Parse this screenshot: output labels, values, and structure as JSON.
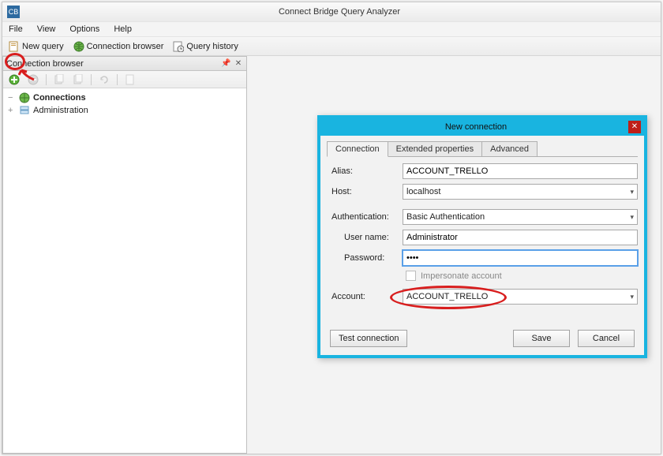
{
  "app": {
    "title": "Connect Bridge Query Analyzer",
    "icon_label": "CB"
  },
  "menu": {
    "file": "File",
    "view": "View",
    "options": "Options",
    "help": "Help"
  },
  "toolbar": {
    "new_query": "New query",
    "connection_browser": "Connection browser",
    "query_history": "Query history"
  },
  "side_panel": {
    "title": "Connection browser",
    "tree": {
      "connections": "Connections",
      "administration": "Administration"
    }
  },
  "dialog": {
    "title": "New connection",
    "tabs": {
      "connection": "Connection",
      "extended": "Extended properties",
      "advanced": "Advanced"
    },
    "labels": {
      "alias": "Alias:",
      "host": "Host:",
      "authentication": "Authentication:",
      "user_name": "User name:",
      "password": "Password:",
      "impersonate": "Impersonate account",
      "account": "Account:"
    },
    "values": {
      "alias": "ACCOUNT_TRELLO",
      "host": "localhost",
      "authentication": "Basic Authentication",
      "user_name": "Administrator",
      "password": "••••",
      "account": "ACCOUNT_TRELLO"
    },
    "buttons": {
      "test": "Test connection",
      "save": "Save",
      "cancel": "Cancel"
    }
  }
}
